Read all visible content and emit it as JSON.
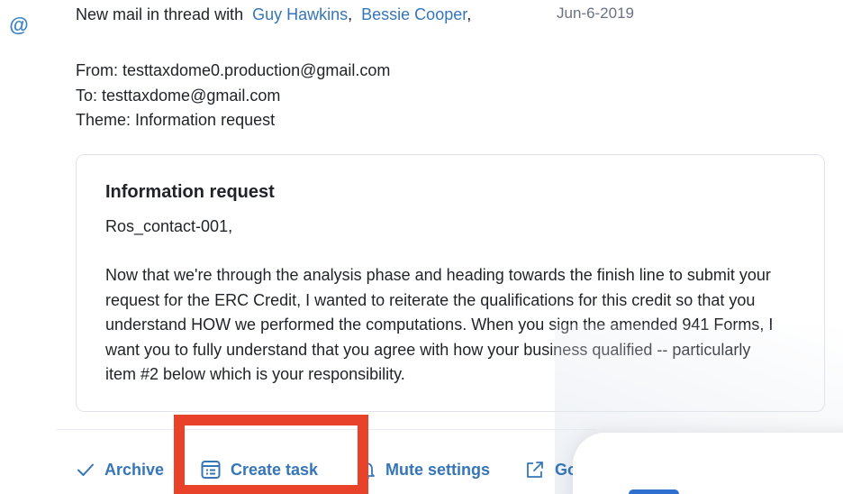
{
  "thread": {
    "prefix": "New mail in thread with",
    "participants": [
      "Guy Hawkins",
      "Bessie Cooper"
    ],
    "date": "Jun-6-2019"
  },
  "meta": {
    "from": "From: testtaxdome0.production@gmail.com",
    "to": "To: testtaxdome@gmail.com",
    "theme": "Theme: Information request"
  },
  "message": {
    "title": "Information request",
    "greeting": "Ros_contact-001,",
    "body_lines": [
      "Now that we're through the analysis phase and heading towards the finish line to submit your",
      "request for the ERC Credit, I wanted to reiterate the qualifications for this credit so that you",
      "understand HOW we performed the computations. When you sign the amended 941 Forms, I",
      "want you to fully understand that you agree with how your business qualified -- particularly",
      "item #2 below which is your responsibility."
    ]
  },
  "actions": {
    "archive": "Archive",
    "create_task": "Create task",
    "mute_settings": "Mute settings",
    "go": "Go"
  },
  "icons": {
    "mention": "at-icon",
    "archive": "check-icon",
    "task": "task-list-icon",
    "mute": "bell-icon",
    "go": "external-link-icon"
  },
  "colors": {
    "link": "#3576b8",
    "highlight": "#e8432a",
    "text": "#1f2328",
    "muted": "#6b7280"
  }
}
